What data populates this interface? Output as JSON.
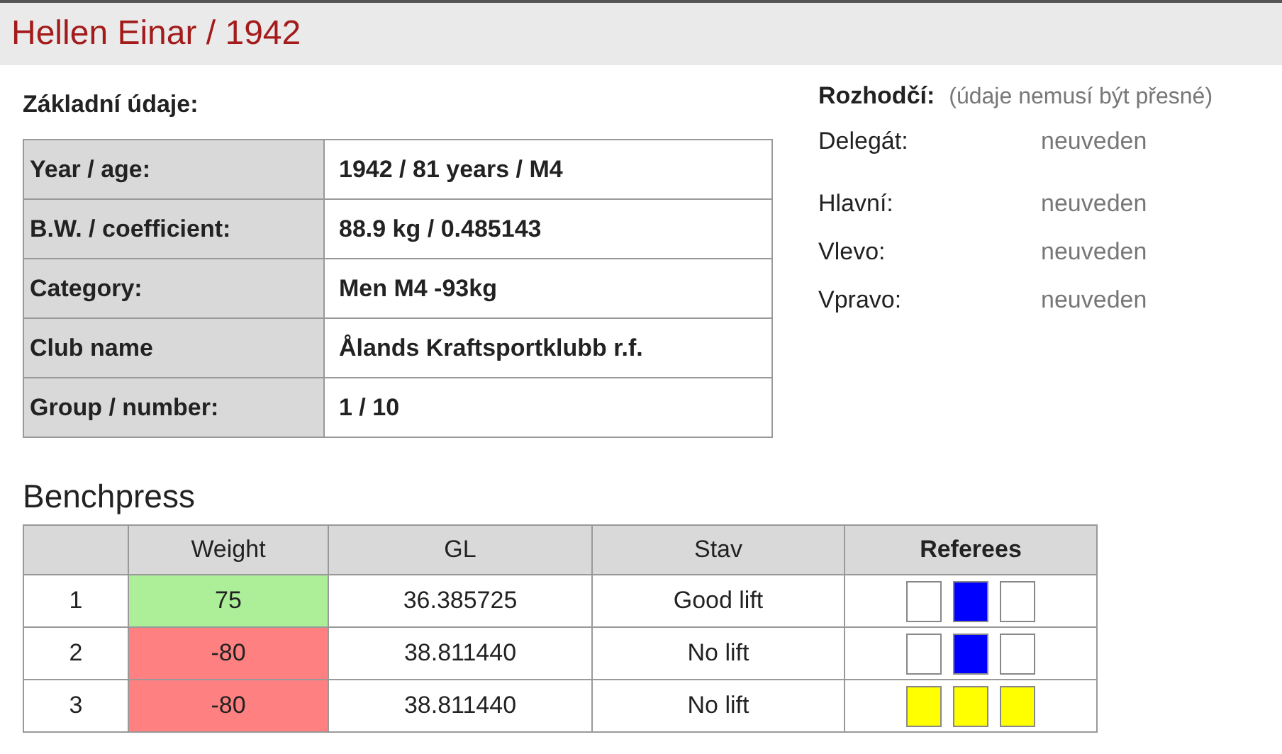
{
  "title": "Hellen Einar / 1942",
  "basic": {
    "heading": "Základní údaje:",
    "rows": [
      {
        "label": "Year / age:",
        "value": "1942 / 81 years / M4"
      },
      {
        "label": "B.W. / coefficient:",
        "value": "88.9 kg / 0.485143"
      },
      {
        "label": "Category:",
        "value": "Men M4 -93kg"
      },
      {
        "label": "Club name",
        "value": "Ålands Kraftsportklubb r.f."
      },
      {
        "label": "Group / number:",
        "value": "1 / 10"
      }
    ]
  },
  "referees": {
    "heading": "Rozhodčí:",
    "note": "(údaje nemusí být přesné)",
    "rows": [
      {
        "label": "Delegát:",
        "value": "neuveden"
      },
      {
        "label": "Hlavní:",
        "value": "neuveden"
      },
      {
        "label": "Vlevo:",
        "value": "neuveden"
      },
      {
        "label": "Vpravo:",
        "value": "neuveden"
      }
    ]
  },
  "bench": {
    "heading": "Benchpress",
    "columns": [
      "Weight",
      "GL",
      "Stav",
      "Referees"
    ],
    "rows": [
      {
        "number": "1",
        "weight": "75",
        "good_lift": true,
        "gl": "36.385725",
        "status": "Good lift",
        "lights": [
          {
            "color": "#ffffff"
          },
          {
            "color": "#0000ff"
          },
          {
            "color": "#ffffff"
          }
        ]
      },
      {
        "number": "2",
        "weight": "-80",
        "good_lift": false,
        "gl": "38.811440",
        "status": "No lift",
        "lights": [
          {
            "color": "#ffffff"
          },
          {
            "color": "#0000ff"
          },
          {
            "color": "#ffffff"
          }
        ]
      },
      {
        "number": "3",
        "weight": "-80",
        "good_lift": false,
        "gl": "38.811440",
        "status": "No lift",
        "lights": [
          {
            "color": "#ffff00"
          },
          {
            "color": "#ffff00"
          },
          {
            "color": "#ffff00"
          }
        ]
      }
    ]
  }
}
